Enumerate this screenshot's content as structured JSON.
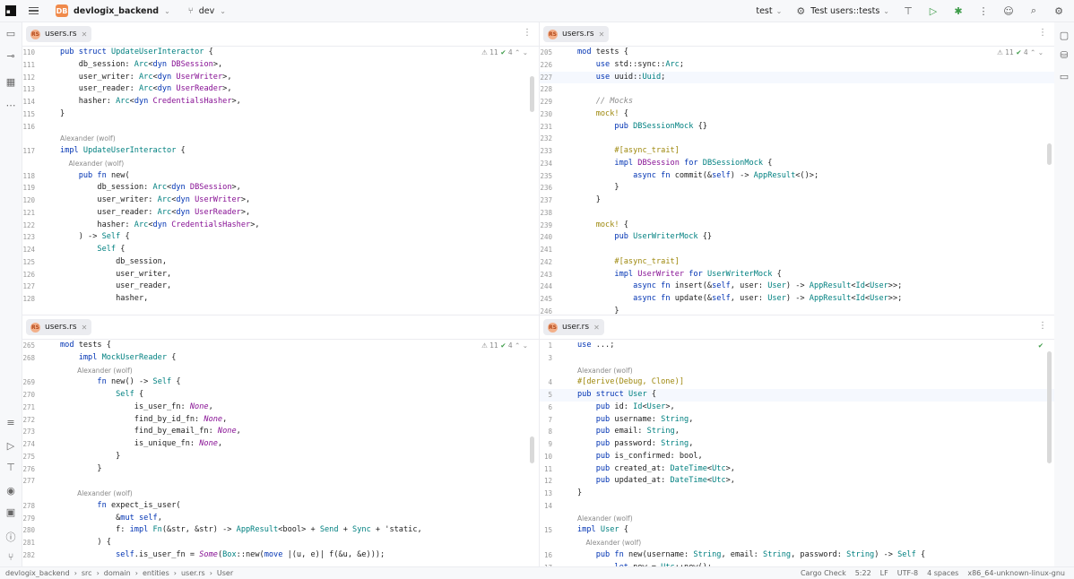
{
  "titlebar": {
    "project_badge": "DB",
    "project_name": "devlogix_backend",
    "branch": "dev",
    "run_target": "test",
    "run_config": "Test users::tests"
  },
  "panes": {
    "top_left": {
      "tab": "users.rs",
      "rs_label": "RS",
      "inspection_warnings": "11",
      "inspection_ok": "4",
      "lines": [
        {
          "n": "110",
          "t": "pub struct UpdateUserInteractor {",
          "k": "struct"
        },
        {
          "n": "111",
          "t": "    db_session: Arc<dyn DBSession>,"
        },
        {
          "n": "112",
          "t": "    user_writer: Arc<dyn UserWriter>,"
        },
        {
          "n": "113",
          "t": "    user_reader: Arc<dyn UserReader>,"
        },
        {
          "n": "114",
          "t": "    hasher: Arc<dyn CredentialsHasher>,"
        },
        {
          "n": "115",
          "t": "}"
        },
        {
          "n": "116",
          "t": ""
        },
        {
          "n": "",
          "t": "Alexander (wolf)",
          "author": true
        },
        {
          "n": "117",
          "t": "impl UpdateUserInteractor {"
        },
        {
          "n": "",
          "t": "    Alexander (wolf)",
          "author": true
        },
        {
          "n": "118",
          "t": "    pub fn new("
        },
        {
          "n": "119",
          "t": "        db_session: Arc<dyn DBSession>,"
        },
        {
          "n": "120",
          "t": "        user_writer: Arc<dyn UserWriter>,"
        },
        {
          "n": "121",
          "t": "        user_reader: Arc<dyn UserReader>,"
        },
        {
          "n": "122",
          "t": "        hasher: Arc<dyn CredentialsHasher>,"
        },
        {
          "n": "123",
          "t": "    ) -> Self {"
        },
        {
          "n": "124",
          "t": "        Self {"
        },
        {
          "n": "125",
          "t": "            db_session,"
        },
        {
          "n": "126",
          "t": "            user_writer,"
        },
        {
          "n": "127",
          "t": "            user_reader,"
        },
        {
          "n": "128",
          "t": "            hasher,"
        }
      ]
    },
    "top_right": {
      "tab": "users.rs",
      "rs_label": "RS",
      "inspection_warnings": "11",
      "inspection_ok": "4",
      "lines": [
        {
          "n": "205",
          "t": "mod tests {"
        },
        {
          "n": "226",
          "t": "    use std::sync::Arc;"
        },
        {
          "n": "227",
          "t": "    use uuid::Uuid;",
          "current": true
        },
        {
          "n": "228",
          "t": ""
        },
        {
          "n": "229",
          "t": "    // Mocks"
        },
        {
          "n": "230",
          "t": "    mock! {"
        },
        {
          "n": "231",
          "t": "        pub DBSessionMock {}"
        },
        {
          "n": "232",
          "t": ""
        },
        {
          "n": "233",
          "t": "        #[async_trait]"
        },
        {
          "n": "234",
          "t": "        impl DBSession for DBSessionMock {"
        },
        {
          "n": "235",
          "t": "            async fn commit(&self) -> AppResult<()>;"
        },
        {
          "n": "236",
          "t": "        }"
        },
        {
          "n": "237",
          "t": "    }"
        },
        {
          "n": "238",
          "t": ""
        },
        {
          "n": "239",
          "t": "    mock! {"
        },
        {
          "n": "240",
          "t": "        pub UserWriterMock {}"
        },
        {
          "n": "241",
          "t": ""
        },
        {
          "n": "242",
          "t": "        #[async_trait]"
        },
        {
          "n": "243",
          "t": "        impl UserWriter for UserWriterMock {"
        },
        {
          "n": "244",
          "t": "            async fn insert(&self, user: User) -> AppResult<Id<User>>;"
        },
        {
          "n": "245",
          "t": "            async fn update(&self, user: User) -> AppResult<Id<User>>;"
        },
        {
          "n": "246",
          "t": "        }"
        }
      ]
    },
    "bottom_left": {
      "tab": "users.rs",
      "rs_label": "RS",
      "inspection_warnings": "11",
      "inspection_ok": "4",
      "lines": [
        {
          "n": "265",
          "t": "mod tests {"
        },
        {
          "n": "268",
          "t": "    impl MockUserReader {"
        },
        {
          "n": "",
          "t": "        Alexander (wolf)",
          "author": true
        },
        {
          "n": "269",
          "t": "        fn new() -> Self {"
        },
        {
          "n": "270",
          "t": "            Self {"
        },
        {
          "n": "271",
          "t": "                is_user_fn: None,"
        },
        {
          "n": "272",
          "t": "                find_by_id_fn: None,"
        },
        {
          "n": "273",
          "t": "                find_by_email_fn: None,"
        },
        {
          "n": "274",
          "t": "                is_unique_fn: None,"
        },
        {
          "n": "275",
          "t": "            }"
        },
        {
          "n": "276",
          "t": "        }"
        },
        {
          "n": "277",
          "t": ""
        },
        {
          "n": "",
          "t": "        Alexander (wolf)",
          "author": true
        },
        {
          "n": "278",
          "t": "        fn expect_is_user("
        },
        {
          "n": "279",
          "t": "            &mut self,"
        },
        {
          "n": "280",
          "t": "            f: impl Fn(&str, &str) -> AppResult<bool> + Send + Sync + 'static,"
        },
        {
          "n": "281",
          "t": "        ) {"
        },
        {
          "n": "282",
          "t": "            self.is_user_fn = Some(Box::new(move |(u, e)| f(&u, &e)));"
        }
      ]
    },
    "bottom_right": {
      "tab": "user.rs",
      "rs_label": "RS",
      "lines": [
        {
          "n": "1",
          "t": "use ...;"
        },
        {
          "n": "3",
          "t": ""
        },
        {
          "n": "",
          "t": "Alexander (wolf)",
          "author": true
        },
        {
          "n": "4",
          "t": "#[derive(Debug, Clone)]"
        },
        {
          "n": "5",
          "t": "pub struct User {",
          "current": true
        },
        {
          "n": "6",
          "t": "    pub id: Id<User>,"
        },
        {
          "n": "7",
          "t": "    pub username: String,"
        },
        {
          "n": "8",
          "t": "    pub email: String,"
        },
        {
          "n": "9",
          "t": "    pub password: String,"
        },
        {
          "n": "10",
          "t": "    pub is_confirmed: bool,"
        },
        {
          "n": "11",
          "t": "    pub created_at: DateTime<Utc>,"
        },
        {
          "n": "12",
          "t": "    pub updated_at: DateTime<Utc>,"
        },
        {
          "n": "13",
          "t": "}"
        },
        {
          "n": "14",
          "t": ""
        },
        {
          "n": "",
          "t": "Alexander (wolf)",
          "author": true
        },
        {
          "n": "15",
          "t": "impl User {"
        },
        {
          "n": "",
          "t": "    Alexander (wolf)",
          "author": true
        },
        {
          "n": "16",
          "t": "    pub fn new(username: String, email: String, password: String) -> Self {"
        },
        {
          "n": "17",
          "t": "        let now = Utc::now();"
        }
      ]
    }
  },
  "statusbar": {
    "crumbs": [
      "devlogix_backend",
      "src",
      "domain",
      "entities",
      "user.rs",
      "User"
    ],
    "right": [
      "Cargo Check",
      "5:22",
      "LF",
      "UTF-8",
      "4 spaces",
      "x86_64-unknown-linux-gnu"
    ]
  },
  "colors": {
    "keyword": "#0033b3",
    "type": "#008080",
    "comment": "#8c8c8c",
    "macro": "#9e880d",
    "italic": "#871094"
  }
}
